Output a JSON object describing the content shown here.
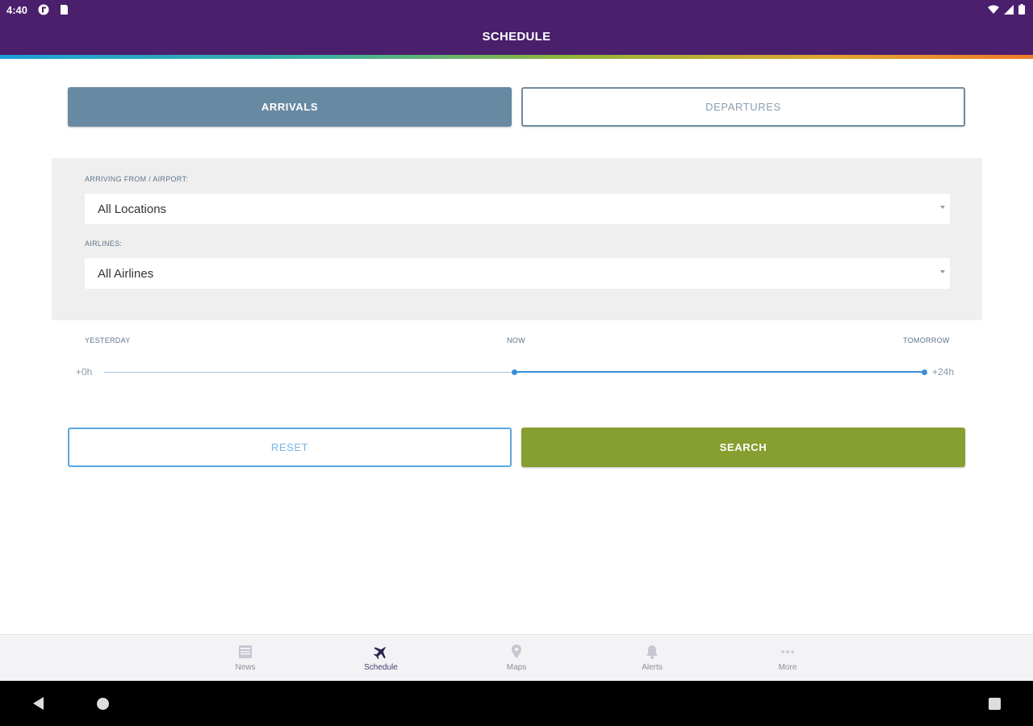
{
  "status_bar": {
    "time": "4:40"
  },
  "header": {
    "title": "SCHEDULE"
  },
  "tabs": {
    "arrivals": "ARRIVALS",
    "departures": "DEPARTURES",
    "selected": "arrivals"
  },
  "filters": {
    "from_label": "ARRIVING FROM / AIRPORT:",
    "from_value": "All Locations",
    "airline_label": "AIRLINES:",
    "airline_value": "All Airlines"
  },
  "time_slider": {
    "label_left": "YESTERDAY",
    "label_center": "NOW",
    "label_right": "TOMORROW",
    "min_text": "+0h",
    "max_text": "+24h",
    "range_start_fraction": 0.5,
    "range_end_fraction": 1.0
  },
  "actions": {
    "reset": "RESET",
    "search": "SEARCH"
  },
  "bottom_nav": {
    "items": [
      {
        "label": "News",
        "icon": "news-icon"
      },
      {
        "label": "Schedule",
        "icon": "plane-icon"
      },
      {
        "label": "Maps",
        "icon": "map-pin-icon"
      },
      {
        "label": "Alerts",
        "icon": "bell-icon"
      },
      {
        "label": "More",
        "icon": "more-dots-icon"
      }
    ],
    "active": "Schedule"
  },
  "colors": {
    "appbar": "#4a1f6b",
    "tab_selected": "#6889a2",
    "search_button": "#879f30",
    "slider": "#3a8fd6"
  }
}
